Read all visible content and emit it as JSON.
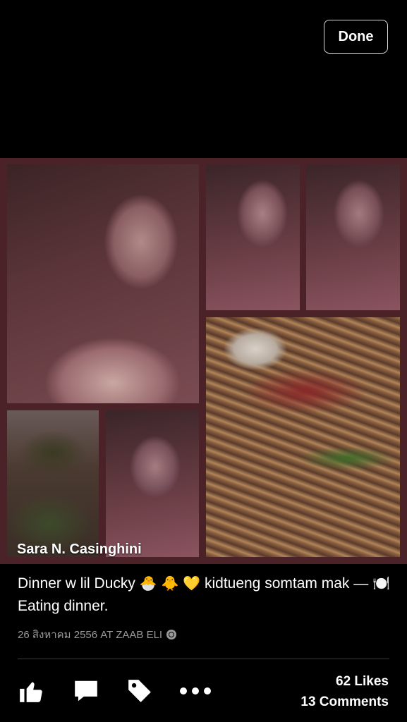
{
  "header": {
    "done_label": "Done"
  },
  "photo": {
    "overlay_name": "Sara N. Casinghini"
  },
  "post": {
    "caption_text": "Dinner w lil Ducky",
    "emojis": [
      "🐣",
      "🐥",
      "💛"
    ],
    "caption_text_2": "kidtueng somtam mak —",
    "activity_icon": "🍽️",
    "activity_text": "Eating dinner.",
    "meta": "26 สิงหาคม 2556 AT ZAAB ELI",
    "privacy_icon": "globe-icon"
  },
  "actions": {
    "like_icon": "thumbs-up-icon",
    "comment_icon": "comment-icon",
    "tag_icon": "tag-icon",
    "more_icon": "more-icon",
    "likes": "62 Likes",
    "comments": "13 Comments"
  }
}
